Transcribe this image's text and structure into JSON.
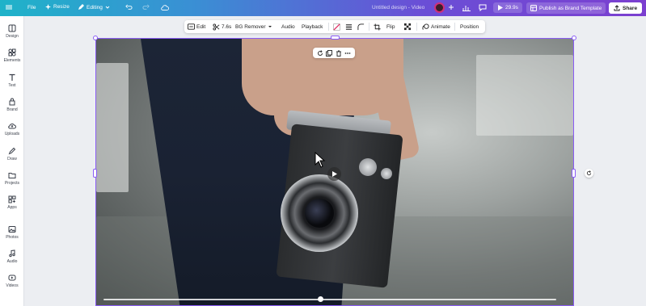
{
  "topbar": {
    "file_label": "File",
    "resize_label": "Resize",
    "editing_label": "Editing",
    "doc_title": "Untitled design - Video",
    "duration": "29.9s",
    "publish_label": "Publish as Brand Template",
    "share_label": "Share",
    "colors": {
      "gradient_start": "#1fb3c9",
      "gradient_end": "#7b3fd0"
    }
  },
  "sidebar": {
    "items": [
      {
        "label": "Design",
        "icon": "design-icon"
      },
      {
        "label": "Elements",
        "icon": "elements-icon"
      },
      {
        "label": "Text",
        "icon": "text-icon"
      },
      {
        "label": "Brand",
        "icon": "brand-icon"
      },
      {
        "label": "Uploads",
        "icon": "uploads-icon"
      },
      {
        "label": "Draw",
        "icon": "draw-icon"
      },
      {
        "label": "Projects",
        "icon": "projects-icon"
      },
      {
        "label": "Apps",
        "icon": "apps-icon"
      },
      {
        "label": "Photos",
        "icon": "photos-icon"
      },
      {
        "label": "Audio",
        "icon": "audio-icon"
      },
      {
        "label": "Videos",
        "icon": "videos-icon"
      }
    ]
  },
  "context_toolbar": {
    "edit_label": "Edit",
    "trim_value": "7.6s",
    "bg_remover_label": "BG Remover",
    "audio_label": "Audio",
    "playback_label": "Playback",
    "flip_label": "Flip",
    "animate_label": "Animate",
    "position_label": "Position"
  },
  "canvas": {
    "selection_color": "#8a5cf5",
    "playback_progress": 0.48
  }
}
